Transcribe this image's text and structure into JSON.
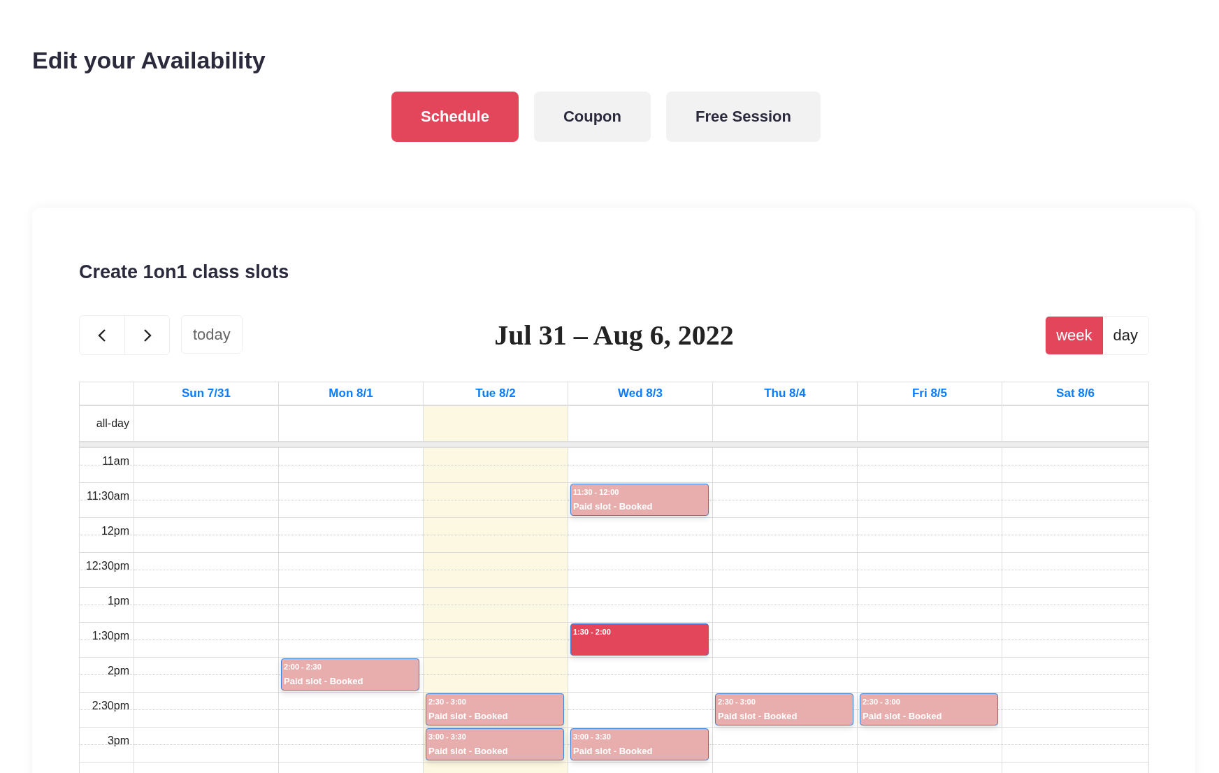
{
  "page_title": "Edit your Availability",
  "tabs": [
    {
      "label": "Schedule",
      "selected": true
    },
    {
      "label": "Coupon",
      "selected": false
    },
    {
      "label": "Free Session",
      "selected": false
    }
  ],
  "card": {
    "title": "Create 1on1 class slots",
    "toolbar": {
      "today_button": "today",
      "range_title": "Jul 31 – Aug 6, 2022",
      "views": [
        {
          "label": "week",
          "selected": true
        },
        {
          "label": "day",
          "selected": false
        }
      ]
    },
    "calendar": {
      "all_day_label": "all-day",
      "days": [
        {
          "label": "Sun 7/31",
          "today": false
        },
        {
          "label": "Mon 8/1",
          "today": false
        },
        {
          "label": "Tue 8/2",
          "today": true
        },
        {
          "label": "Wed 8/3",
          "today": false
        },
        {
          "label": "Thu 8/4",
          "today": false
        },
        {
          "label": "Fri 8/5",
          "today": false
        },
        {
          "label": "Sat 8/6",
          "today": false
        }
      ],
      "time_slots": [
        {
          "label": "11am",
          "cells": [
            {
              "kind": "empty"
            },
            {
              "kind": "empty"
            },
            {
              "kind": "empty"
            },
            {
              "kind": "empty"
            },
            {
              "kind": "empty"
            },
            {
              "kind": "empty"
            },
            {
              "kind": "empty"
            }
          ]
        },
        {
          "label": "11:30am",
          "cells": [
            {
              "kind": "empty"
            },
            {
              "kind": "empty"
            },
            {
              "kind": "empty"
            },
            {
              "kind": "booked",
              "time": "11:30 - 12:00",
              "title": "Paid slot - Booked"
            },
            {
              "kind": "empty"
            },
            {
              "kind": "empty"
            },
            {
              "kind": "empty"
            }
          ]
        },
        {
          "label": "12pm",
          "cells": [
            {
              "kind": "empty"
            },
            {
              "kind": "empty"
            },
            {
              "kind": "empty"
            },
            {
              "kind": "empty"
            },
            {
              "kind": "empty"
            },
            {
              "kind": "empty"
            },
            {
              "kind": "empty"
            }
          ]
        },
        {
          "label": "12:30pm",
          "cells": [
            {
              "kind": "empty"
            },
            {
              "kind": "empty"
            },
            {
              "kind": "empty"
            },
            {
              "kind": "empty"
            },
            {
              "kind": "empty"
            },
            {
              "kind": "empty"
            },
            {
              "kind": "empty"
            }
          ]
        },
        {
          "label": "1pm",
          "cells": [
            {
              "kind": "empty"
            },
            {
              "kind": "empty"
            },
            {
              "kind": "empty"
            },
            {
              "kind": "empty"
            },
            {
              "kind": "empty"
            },
            {
              "kind": "empty"
            },
            {
              "kind": "empty"
            }
          ]
        },
        {
          "label": "1:30pm",
          "cells": [
            {
              "kind": "empty"
            },
            {
              "kind": "empty"
            },
            {
              "kind": "empty"
            },
            {
              "kind": "open",
              "time": "1:30 - 2:00"
            },
            {
              "kind": "empty"
            },
            {
              "kind": "empty"
            },
            {
              "kind": "empty"
            }
          ]
        },
        {
          "label": "2pm",
          "cells": [
            {
              "kind": "empty"
            },
            {
              "kind": "booked",
              "time": "2:00 - 2:30",
              "title": "Paid slot - Booked"
            },
            {
              "kind": "empty"
            },
            {
              "kind": "empty"
            },
            {
              "kind": "empty"
            },
            {
              "kind": "empty"
            },
            {
              "kind": "empty"
            }
          ]
        },
        {
          "label": "2:30pm",
          "cells": [
            {
              "kind": "empty"
            },
            {
              "kind": "empty"
            },
            {
              "kind": "booked",
              "time": "2:30 - 3:00",
              "title": "Paid slot - Booked"
            },
            {
              "kind": "empty"
            },
            {
              "kind": "booked",
              "time": "2:30 - 3:00",
              "title": "Paid slot - Booked"
            },
            {
              "kind": "booked",
              "time": "2:30 - 3:00",
              "title": "Paid slot - Booked"
            },
            {
              "kind": "empty"
            }
          ]
        },
        {
          "label": "3pm",
          "cells": [
            {
              "kind": "empty"
            },
            {
              "kind": "empty"
            },
            {
              "kind": "booked",
              "time": "3:00 - 3:30",
              "title": "Paid slot - Booked"
            },
            {
              "kind": "booked",
              "time": "3:00 - 3:30",
              "title": "Paid slot - Booked"
            },
            {
              "kind": "empty"
            },
            {
              "kind": "empty"
            },
            {
              "kind": "empty"
            }
          ]
        }
      ]
    }
  }
}
